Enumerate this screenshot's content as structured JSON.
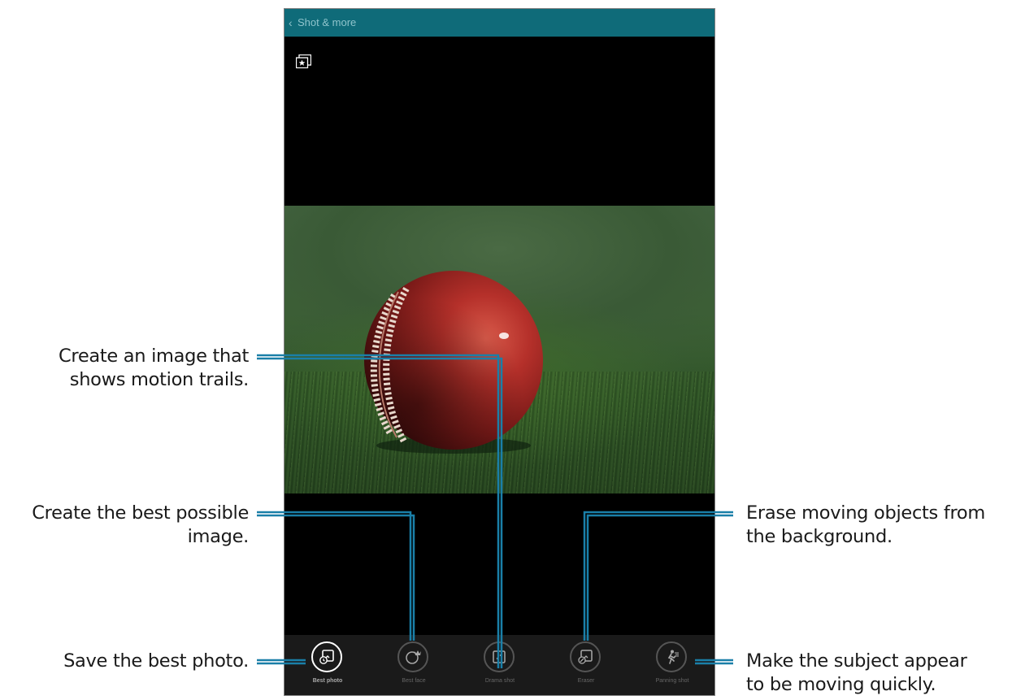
{
  "appbar": {
    "back_glyph": "‹",
    "title": "Shot & more"
  },
  "modes": [
    {
      "label": "Best photo",
      "icon": "best-photo-icon",
      "active": true
    },
    {
      "label": "Best face",
      "icon": "best-face-icon",
      "active": false
    },
    {
      "label": "Drama shot",
      "icon": "drama-shot-icon",
      "active": false
    },
    {
      "label": "Eraser",
      "icon": "eraser-icon",
      "active": false
    },
    {
      "label": "Panning shot",
      "icon": "panning-shot-icon",
      "active": false
    }
  ],
  "callouts": {
    "drama": [
      "Create an image that",
      "shows motion trails."
    ],
    "best_face": [
      "Create the best possible",
      "image."
    ],
    "best_photo": [
      "Save the best photo."
    ],
    "eraser": [
      "Erase moving objects from",
      "the background."
    ],
    "panning": [
      "Make the subject appear",
      "to be moving quickly."
    ]
  },
  "colors": {
    "appbar": "#0f6b79",
    "callout_line": "#1a7fa8"
  }
}
